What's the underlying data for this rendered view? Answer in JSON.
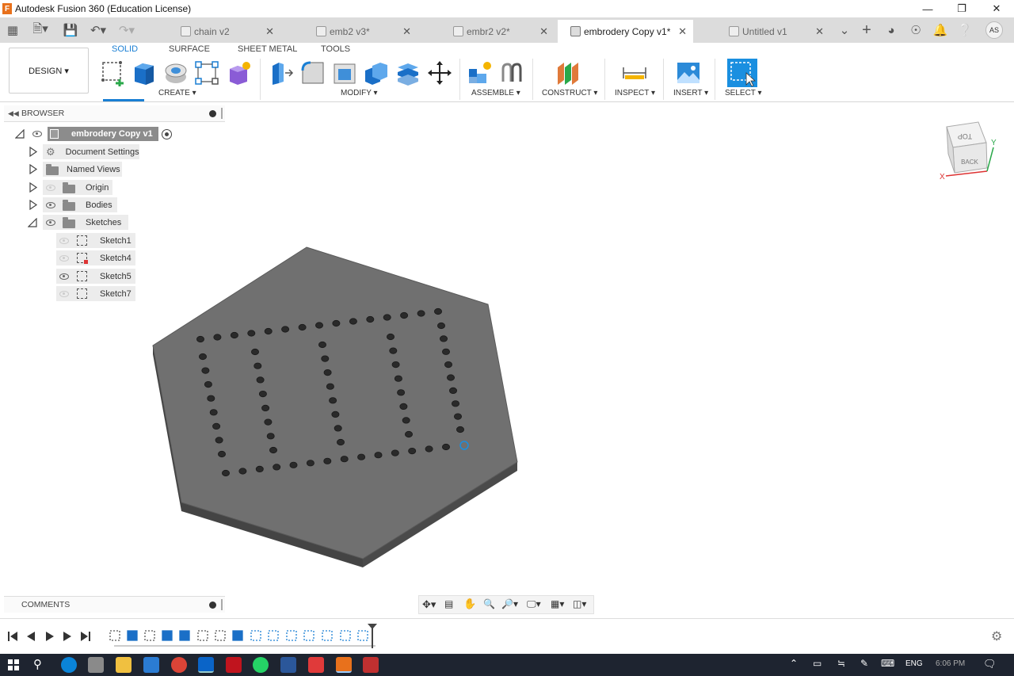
{
  "window": {
    "title": "Autodesk Fusion 360 (Education License)",
    "logo_letter": "F"
  },
  "tabs": [
    {
      "label": "chain v2"
    },
    {
      "label": "emb2 v3*"
    },
    {
      "label": "embr2 v2*"
    },
    {
      "label": "embrodery Copy v1*",
      "active": true
    },
    {
      "label": "Untitled v1"
    }
  ],
  "user_initials": "AS",
  "workspace_button": "DESIGN ▾",
  "ribbon_tabs": [
    "SOLID",
    "SURFACE",
    "SHEET METAL",
    "TOOLS"
  ],
  "ribbon_groups": [
    "CREATE ▾",
    "MODIFY ▾",
    "ASSEMBLE ▾",
    "CONSTRUCT ▾",
    "INSPECT ▾",
    "INSERT ▾",
    "SELECT ▾"
  ],
  "browser": {
    "title": "BROWSER",
    "root": "embrodery Copy v1",
    "items": [
      "Document Settings",
      "Named Views",
      "Origin",
      "Bodies",
      "Sketches"
    ],
    "sketches": [
      "Sketch1",
      "Sketch4",
      "Sketch5",
      "Sketch7"
    ]
  },
  "viewcube": {
    "face_top": "TOP",
    "face_back": "BACK",
    "axis_x": "X",
    "axis_y": "Y"
  },
  "comments": {
    "title": "COMMENTS"
  },
  "taskbar": {
    "lang": "ENG",
    "time": "6:06 PM"
  },
  "colors": {
    "accent": "#1a7fd4",
    "model_face": "#707070",
    "model_edge": "#3c3c3c",
    "taskbar": "#1e2430"
  }
}
